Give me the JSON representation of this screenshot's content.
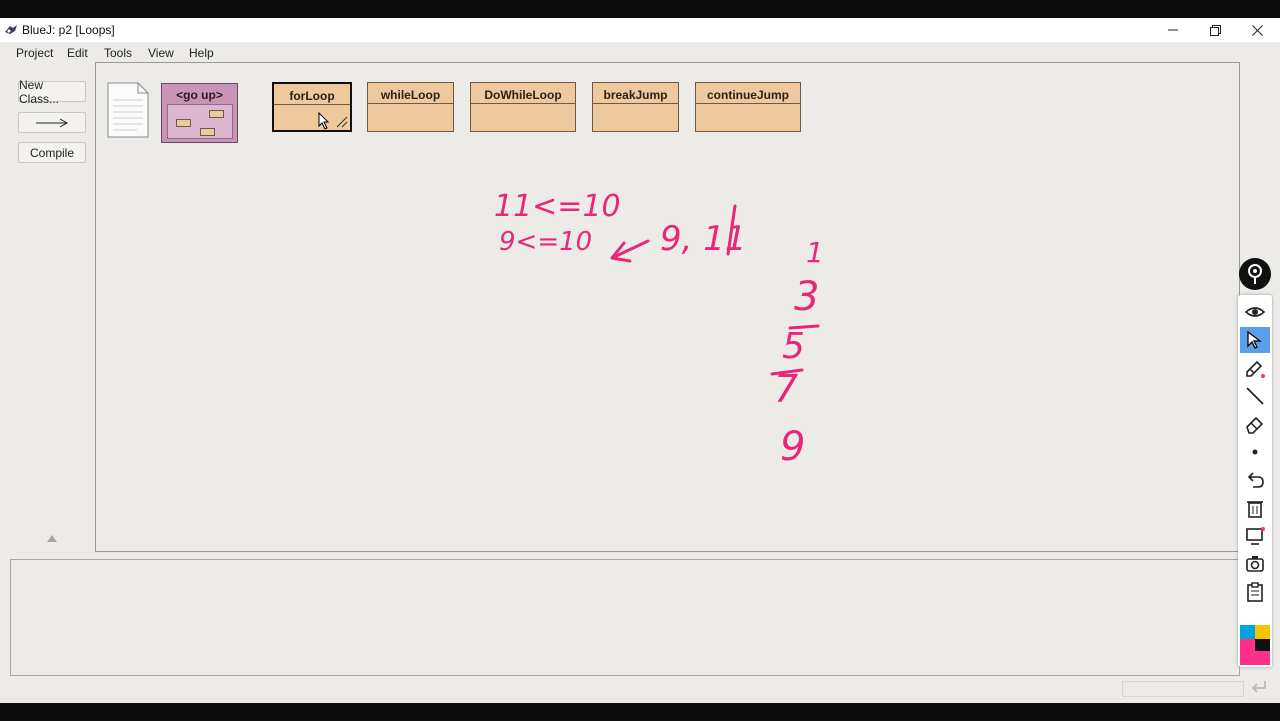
{
  "window": {
    "title": "BlueJ:  p2  [Loops]"
  },
  "menu": [
    "Project",
    "Edit",
    "Tools",
    "View",
    "Help"
  ],
  "sidebar": {
    "new_class": "New Class...",
    "compile": "Compile"
  },
  "package": {
    "label": "<go up>"
  },
  "classes": [
    "forLoop",
    "whileLoop",
    "DoWhileLoop",
    "breakJump",
    "continueJump"
  ],
  "annotations": {
    "line1": "11<=10",
    "line2": "9<=10",
    "arrow_note": "9, 11",
    "sequence": [
      "1",
      "3",
      "5",
      "7",
      "9"
    ],
    "ink_color": "#e8267a"
  },
  "tool_icons": [
    "pin-icon",
    "eye-icon",
    "cursor-icon",
    "pencil-icon",
    "line-icon",
    "eraser-icon",
    "dot-icon",
    "undo-icon",
    "trash-icon",
    "screen-icon",
    "camera-icon",
    "clipboard-icon"
  ],
  "palette": [
    "#00a3e0",
    "#f5c400",
    "#111111",
    "#ff2f8a"
  ]
}
